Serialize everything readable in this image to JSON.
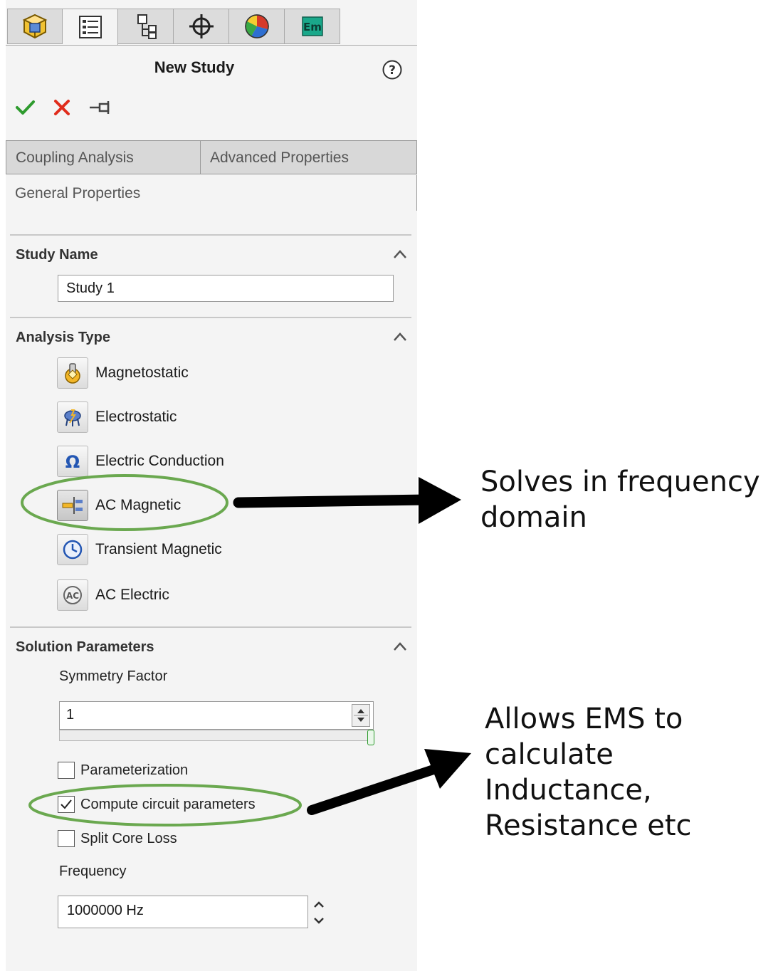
{
  "title": "New Study",
  "top_tabs": [
    {
      "icon": "part-icon"
    },
    {
      "icon": "property-manager-icon"
    },
    {
      "icon": "configuration-manager-icon"
    },
    {
      "icon": "crosshair-icon"
    },
    {
      "icon": "appearance-icon"
    },
    {
      "icon": "em",
      "label": "Em"
    }
  ],
  "property_tabs": {
    "coupling": "Coupling Analysis",
    "advanced": "Advanced Properties",
    "general": "General Properties"
  },
  "study_name": {
    "title": "Study Name",
    "value": "Study 1"
  },
  "analysis_type": {
    "title": "Analysis Type",
    "items": [
      {
        "label": "Magnetostatic",
        "icon": "magnetostatic-icon"
      },
      {
        "label": "Electrostatic",
        "icon": "electrostatic-icon"
      },
      {
        "label": "Electric Conduction",
        "icon": "omega-icon"
      },
      {
        "label": "AC Magnetic",
        "icon": "ac-magnetic-icon",
        "selected": true
      },
      {
        "label": "Transient Magnetic",
        "icon": "clock-icon"
      },
      {
        "label": "AC Electric",
        "icon": "ac-electric-icon"
      }
    ]
  },
  "solution_parameters": {
    "title": "Solution Parameters",
    "symmetry_label": "Symmetry Factor",
    "symmetry_value": "1",
    "parameterization": {
      "label": "Parameterization",
      "checked": false
    },
    "compute_circuit": {
      "label": "Compute circuit parameters",
      "checked": true
    },
    "split_core_loss": {
      "label": "Split Core Loss",
      "checked": false
    },
    "frequency_label": "Frequency",
    "frequency_value": "1000000 Hz"
  },
  "annotations": {
    "callout1": [
      "Solves in frequency",
      "domain"
    ],
    "callout2": [
      "Allows EMS to",
      "calculate",
      "Inductance,",
      "Resistance etc"
    ]
  },
  "colors": {
    "highlight": "#6aa84f",
    "check": "#2e9b2e",
    "cancel": "#e02b1b",
    "arrow": "#000000"
  }
}
